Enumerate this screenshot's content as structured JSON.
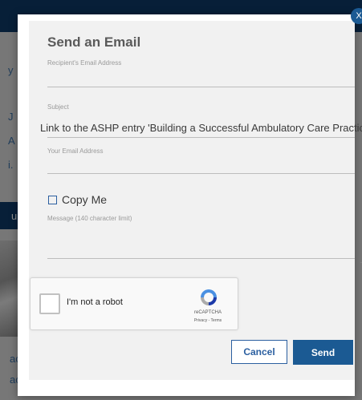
{
  "modal": {
    "title": "Send an Email",
    "close_label": "X",
    "recipient_label": "Recipient's Email Address",
    "recipient_value": "",
    "subject_label": "Subject",
    "subject_value": "Link to the ASHP entry 'Building a Successful Ambulatory Care Practice'",
    "your_email_label": "Your Email Address",
    "your_email_value": "",
    "copy_me_label": "Copy Me",
    "message_label": "Message (140 character limit)",
    "message_value": "",
    "cancel_label": "Cancel",
    "send_label": "Send"
  },
  "recaptcha": {
    "label": "I'm not a robot",
    "brand": "reCAPTCHA",
    "terms": "Privacy - Terms"
  },
  "background": {
    "fragments": [
      "y",
      "J",
      "A",
      "i.",
      "u",
      "ac",
      "ac"
    ]
  },
  "colors": {
    "primary": "#1b5a93",
    "header": "#0d3966",
    "panel": "#f1f1f1"
  }
}
